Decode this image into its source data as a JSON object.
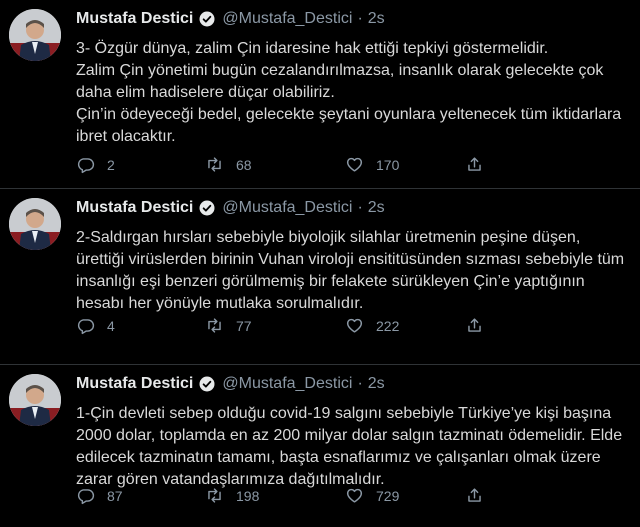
{
  "tweets": [
    {
      "author_name": "Mustafa Destici",
      "handle": "@Mustafa_Destici",
      "separator": "·",
      "time": "2s",
      "text": "3- Özgür dünya, zalim Çin idaresine hak ettiği tepkiyi göstermelidir.\nZalim  Çin yönetimi bugün cezalandırılmazsa, insanlık olarak gelecekte çok daha elim hadiselere düçar olabiliriz.\nÇin’in ödeyeceği bedel, gelecekte şeytani oyunlara yeltenecek tüm iktidarlara ibret olacaktır.",
      "replies": "2",
      "retweets": "68",
      "likes": "170"
    },
    {
      "author_name": "Mustafa Destici",
      "handle": "@Mustafa_Destici",
      "separator": "·",
      "time": "2s",
      "text": "2-Saldırgan hırsları sebebiyle biyolojik silahlar üretmenin peşine düşen, ürettiği virüslerden birinin Vuhan viroloji ensititüsünden sızması sebebiyle tüm insanlığı eşi benzeri görülmemiş bir felakete sürükleyen Çin’e yaptığının hesabı her yönüyle mutlaka sorulmalıdır.",
      "replies": "4",
      "retweets": "77",
      "likes": "222"
    },
    {
      "author_name": "Mustafa Destici",
      "handle": "@Mustafa_Destici",
      "separator": "·",
      "time": "2s",
      "text": "1-Çin devleti sebep olduğu covid-19 salgını sebebiyle Türkiye’ye kişi başına 2000 dolar, toplamda en az 200 milyar dolar salgın tazminatı ödemelidir. Elde edilecek tazminatın tamamı, başta esnaflarımız ve çalışanları olmak üzere zarar gören vatandaşlarımıza dağıtılmalıdır.",
      "replies": "87",
      "retweets": "198",
      "likes": "729"
    }
  ],
  "icons": {
    "avatar": "avatar-photo",
    "verified": "verified-badge-icon",
    "reply": "reply-icon",
    "retweet": "retweet-icon",
    "like": "heart-icon"
  },
  "colors": {
    "background": "#000000",
    "text": "#d9d9d9",
    "muted": "#8b98a5",
    "divider": "#2f3336"
  }
}
